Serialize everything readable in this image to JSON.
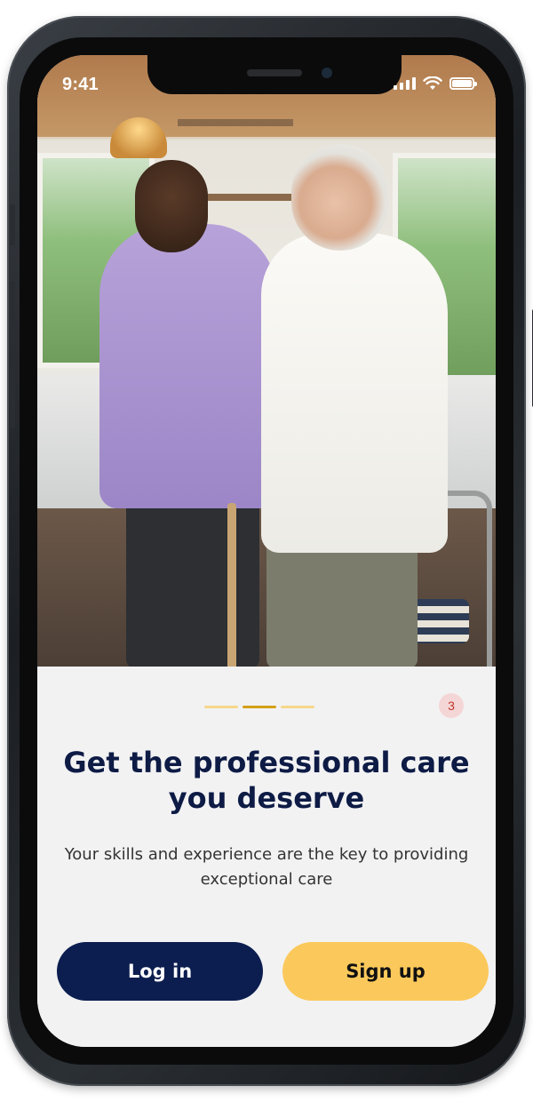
{
  "status_bar": {
    "time": "9:41",
    "signal_icon": "signal-icon",
    "wifi_icon": "wifi-icon",
    "battery_icon": "battery-icon"
  },
  "hero_image": {
    "subject": "caregiver-assisting-elderly-woman-with-cane"
  },
  "pager": {
    "total": 3,
    "active_index": 1,
    "active_color": "#D4A017",
    "inactive_color": "#F6D88A"
  },
  "badge": {
    "count": "3",
    "color": "#C0392B",
    "background": "#F5D6D6"
  },
  "onboarding": {
    "title": "Get the professional care you deserve",
    "subtitle": "Your skills and experience are the key to providing exceptional care"
  },
  "actions": {
    "login_label": "Log in",
    "signup_label": "Sign up"
  },
  "colors": {
    "primary": "#0C1E4F",
    "accent": "#FBC95B",
    "panel_background": "#F2F2F3",
    "title_text": "#0D1B45"
  }
}
